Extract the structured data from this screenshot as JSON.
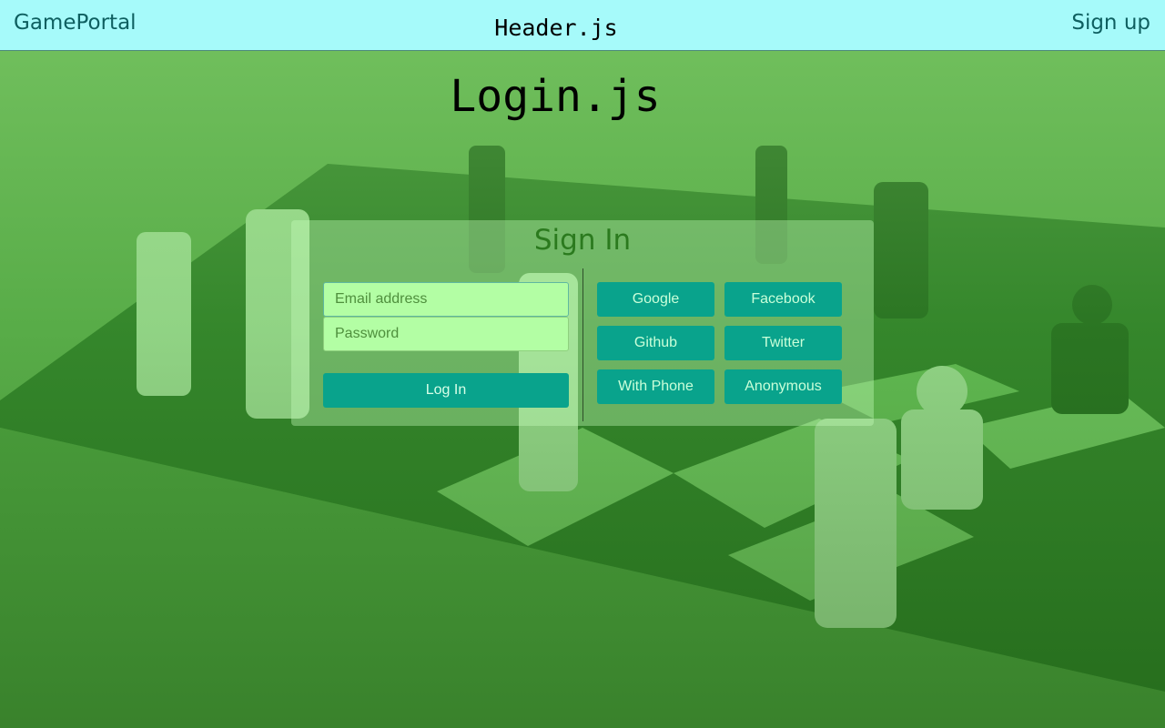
{
  "header": {
    "brand": "GamePortal",
    "title": "Header.js",
    "signup_label": "Sign up",
    "background_color": "#a6fafa"
  },
  "page": {
    "title": "Login.js"
  },
  "signin": {
    "title": "Sign In",
    "email_placeholder": "Email address",
    "password_placeholder": "Password",
    "login_label": "Log In",
    "providers": {
      "google": "Google",
      "facebook": "Facebook",
      "github": "Github",
      "twitter": "Twitter",
      "phone": "With Phone",
      "anonymous": "Anonymous"
    },
    "button_color": "#09a38c"
  }
}
